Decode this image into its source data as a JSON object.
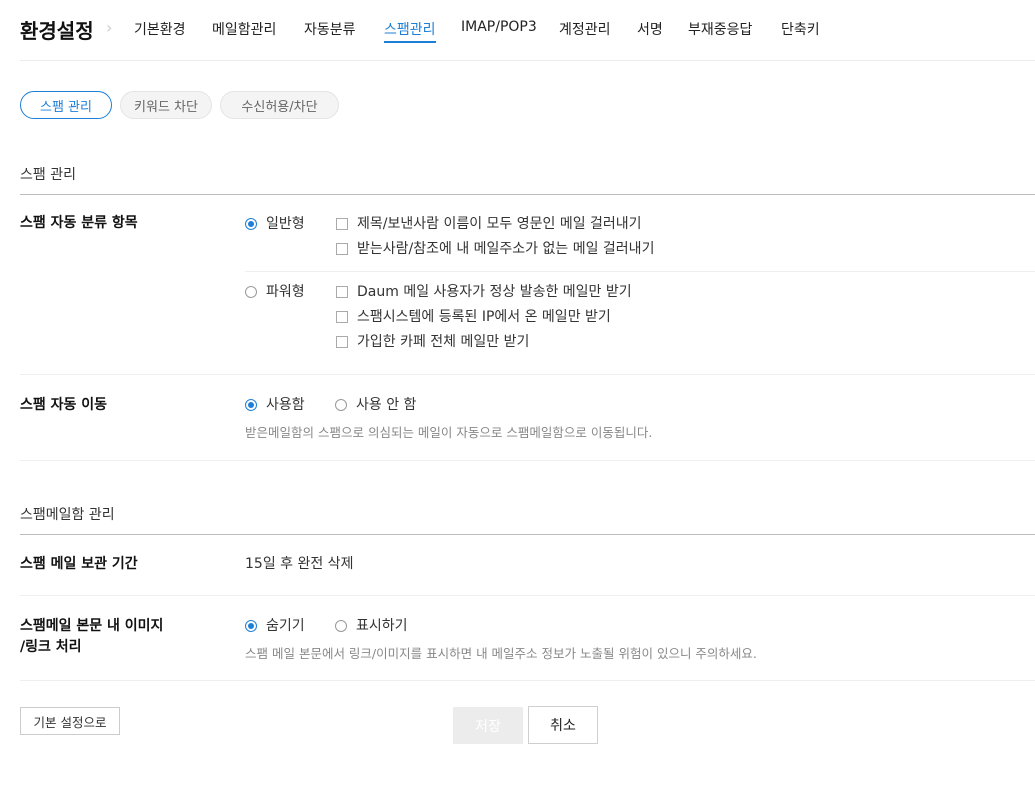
{
  "header": {
    "title": "환경설정",
    "nav": [
      {
        "label": "기본환경"
      },
      {
        "label": "메일함관리"
      },
      {
        "label": "자동분류"
      },
      {
        "label": "스팸관리",
        "active": true
      },
      {
        "label": "IMAP/POP3"
      },
      {
        "label": "계정관리"
      },
      {
        "label": "서명"
      },
      {
        "label": "부재중응답"
      },
      {
        "label": "단축키"
      }
    ]
  },
  "subtabs": [
    {
      "label": "스팸 관리",
      "active": true
    },
    {
      "label": "키워드 차단"
    },
    {
      "label": "수신허용/차단"
    }
  ],
  "spam_section": {
    "title": "스팸 관리",
    "auto_classify": {
      "label": "스팸 자동 분류 항목",
      "normal": {
        "label": "일반형",
        "selected": true,
        "options": [
          "제목/보낸사람 이름이 모두 영문인 메일 걸러내기",
          "받는사람/참조에 내 메일주소가 없는 메일 걸러내기"
        ]
      },
      "power": {
        "label": "파워형",
        "selected": false,
        "options": [
          "Daum 메일 사용자가 정상 발송한 메일만 받기",
          "스팸시스템에 등록된 IP에서 온 메일만 받기",
          "가입한 카페 전체 메일만 받기"
        ]
      }
    },
    "auto_move": {
      "label": "스팸 자동 이동",
      "options": [
        {
          "label": "사용함",
          "selected": true
        },
        {
          "label": "사용 안 함",
          "selected": false
        }
      ],
      "description": "받은메일함의 스팸으로 의심되는 메일이 자동으로 스팸메일함으로 이동됩니다."
    }
  },
  "spambox_section": {
    "title": "스팸메일함 관리",
    "retention": {
      "label": "스팸 메일 보관 기간",
      "value": "15일 후 완전 삭제"
    },
    "image_link": {
      "label_line1": "스팸메일 본문 내 이미지",
      "label_line2": "/링크 처리",
      "options": [
        {
          "label": "숨기기",
          "selected": true
        },
        {
          "label": "표시하기",
          "selected": false
        }
      ],
      "description": "스팸 메일 본문에서 링크/이미지를 표시하면 내 메일주소 정보가 노출될 위험이 있으니 주의하세요."
    }
  },
  "footer": {
    "reset_label": "기본 설정으로",
    "save_label": "저장",
    "cancel_label": "취소"
  },
  "colors": {
    "accent": "#1e7fd6",
    "save_disabled_bg": "#ececec"
  }
}
